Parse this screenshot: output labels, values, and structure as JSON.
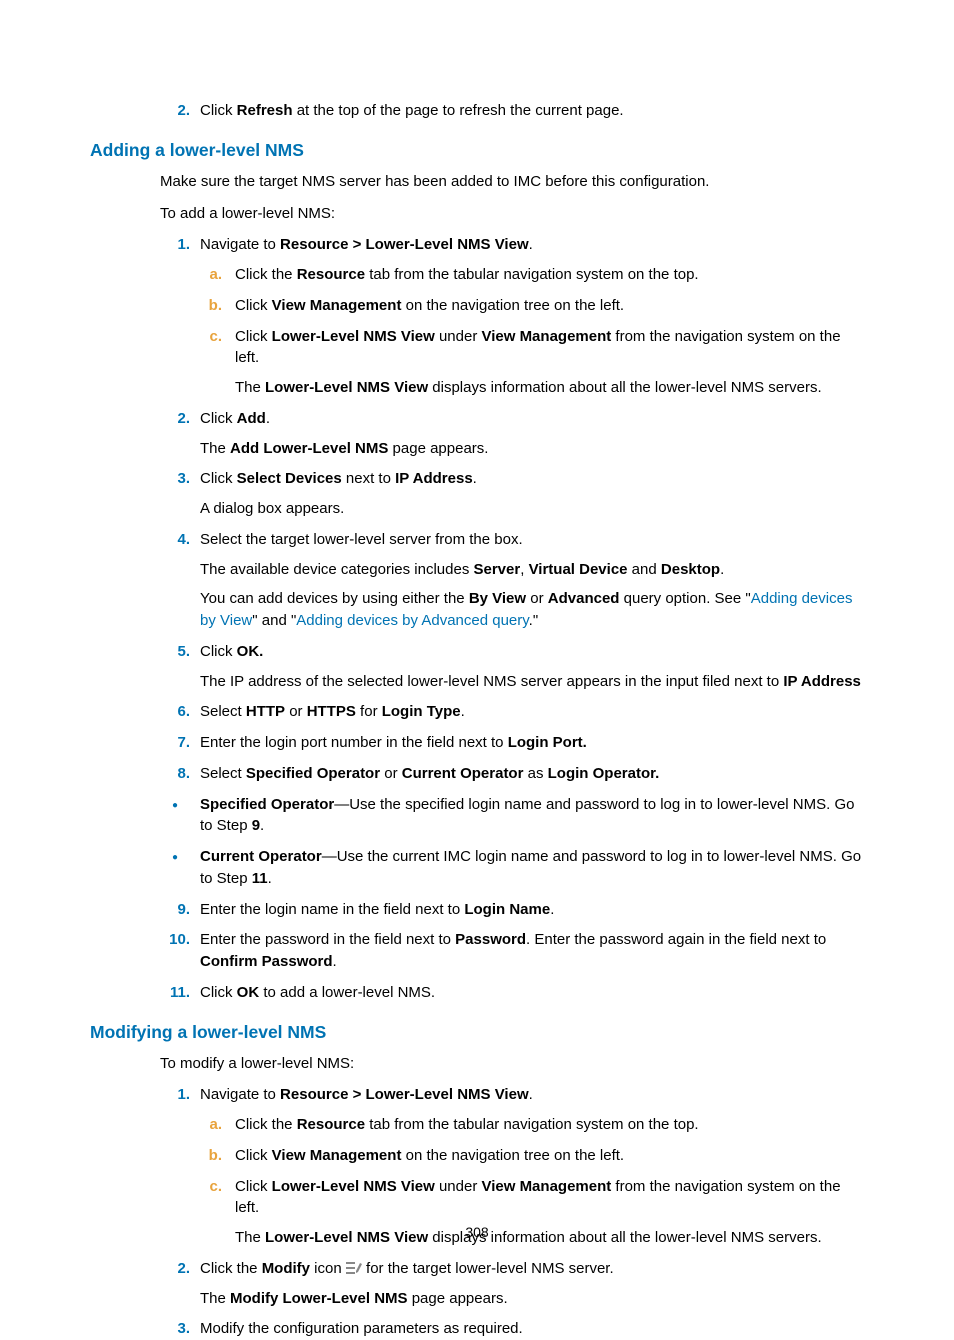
{
  "top_step": {
    "num": "2.",
    "pre": "Click ",
    "bold": "Refresh",
    "post": " at the top of the page to refresh the current page."
  },
  "sec1": {
    "heading": "Adding a lower-level NMS",
    "intro1": "Make sure the target NMS server has been added to IMC before this configuration.",
    "intro2": "To add a lower-level NMS:",
    "s1": {
      "num": "1.",
      "t1": "Navigate to ",
      "b1": "Resource > Lower-Level NMS View",
      "t2": ".",
      "a": {
        "num": "a.",
        "t1": "Click the ",
        "b1": "Resource",
        "t2": " tab from the tabular navigation system on the top."
      },
      "b": {
        "num": "b.",
        "t1": "Click ",
        "b1": "View Management",
        "t2": " on the navigation tree on the left."
      },
      "c": {
        "num": "c.",
        "t1": "Click ",
        "b1": "Lower-Level NMS View",
        "t2": " under ",
        "b2": "View Management",
        "t3": " from the navigation system on the left."
      },
      "c2": {
        "t1": "The ",
        "b1": "Lower-Level NMS View",
        "t2": " displays information about all the lower-level NMS servers."
      }
    },
    "s2": {
      "num": "2.",
      "t1": "Click ",
      "b1": "Add",
      "t2": ".",
      "p2": {
        "t1": "The ",
        "b1": "Add Lower-Level NMS",
        "t2": " page appears."
      }
    },
    "s3": {
      "num": "3.",
      "t1": "Click ",
      "b1": "Select Devices",
      "t2": " next to ",
      "b2": "IP Address",
      "t3": ".",
      "p2": "A dialog box appears."
    },
    "s4": {
      "num": "4.",
      "t1": "Select the target lower-level server from the box.",
      "p2": {
        "t1": "The available device categories includes ",
        "b1": "Server",
        "t2": ", ",
        "b2": "Virtual Device",
        "t3": " and ",
        "b3": "Desktop",
        "t4": "."
      },
      "p3": {
        "t1": "You can add devices by using either the ",
        "b1": "By View",
        "t2": " or ",
        "b2": "Advanced",
        "t3": " query option. See \"",
        "l1": "Adding devices by View",
        "t4": "\" and \"",
        "l2": "Adding devices by Advanced query",
        "t5": ".\""
      }
    },
    "s5": {
      "num": "5.",
      "t1": "Click ",
      "b1": "OK.",
      "p2": {
        "t1": "The IP address of the selected lower-level NMS server appears in the input filed next to ",
        "b1": "IP Address"
      }
    },
    "s6": {
      "num": "6.",
      "t1": "Select ",
      "b1": "HTTP",
      "t2": " or ",
      "b2": "HTTPS",
      "t3": " for ",
      "b3": "Login Type",
      "t4": "."
    },
    "s7": {
      "num": "7.",
      "t1": "Enter the login port number in the field next to ",
      "b1": "Login Port."
    },
    "s8": {
      "num": "8.",
      "t1": "Select ",
      "b1": "Specified Operator",
      "t2": " or ",
      "b2": "Current Operator",
      "t3": " as ",
      "b3": "Login Operator."
    },
    "bul1": {
      "b1": "Specified Operator",
      "t1": "—Use the specified login name and password to log in to lower-level NMS. Go to Step ",
      "b2": "9",
      "t2": "."
    },
    "bul2": {
      "b1": "Current Operator",
      "t1": "—Use the current IMC login name and password to log in to lower-level NMS. Go to Step ",
      "b2": "11",
      "t2": "."
    },
    "s9": {
      "num": "9.",
      "t1": "Enter the login name in the field next to ",
      "b1": "Login Name",
      "t2": "."
    },
    "s10": {
      "num": "10.",
      "t1": "Enter the password in the field next to ",
      "b1": "Password",
      "t2": ". Enter the password again in the field next to ",
      "b2": "Confirm Password",
      "t3": "."
    },
    "s11": {
      "num": "11.",
      "t1": "Click ",
      "b1": "OK",
      "t2": " to add a lower-level NMS."
    }
  },
  "sec2": {
    "heading": "Modifying a lower-level NMS",
    "intro": "To modify a lower-level NMS:",
    "s1": {
      "num": "1.",
      "t1": "Navigate to ",
      "b1": "Resource > Lower-Level NMS View",
      "t2": ".",
      "a": {
        "num": "a.",
        "t1": "Click the ",
        "b1": "Resource",
        "t2": " tab from the tabular navigation system on the top."
      },
      "b": {
        "num": "b.",
        "t1": "Click ",
        "b1": "View Management",
        "t2": " on the navigation tree on the left."
      },
      "c": {
        "num": "c.",
        "t1": "Click ",
        "b1": "Lower-Level NMS View",
        "t2": " under ",
        "b2": "View Management",
        "t3": " from the navigation system on the left."
      },
      "c2": {
        "t1": "The ",
        "b1": "Lower-Level NMS View",
        "t2": " displays information about all the lower-level NMS servers."
      }
    },
    "s2": {
      "num": "2.",
      "t1": "Click the ",
      "b1": "Modify",
      "t2": " icon ",
      "t3": " for the target lower-level NMS server.",
      "p2": {
        "t1": "The ",
        "b1": "Modify Lower-Level NMS",
        "t2": " page appears."
      }
    },
    "s3": {
      "num": "3.",
      "t1": "Modify the configuration parameters as required."
    }
  },
  "pagenum": "308",
  "bullet": "●"
}
